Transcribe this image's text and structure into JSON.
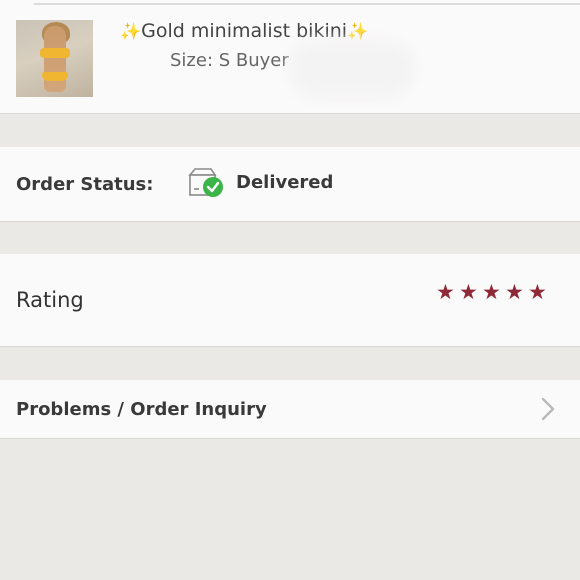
{
  "product": {
    "title_prefix": "✨",
    "title": "Gold minimalist bikini",
    "title_suffix": "✨",
    "size_line": "Size: S  Buyer"
  },
  "order_status": {
    "label": "Order Status:",
    "value": "Delivered",
    "icon": "delivered-box-icon",
    "status_color": "#3bb54a"
  },
  "rating": {
    "label": "Rating",
    "stars": 5,
    "star_color": "#8e2a37"
  },
  "problems": {
    "label": "Problems / Order Inquiry",
    "icon": "chevron-right-icon"
  }
}
